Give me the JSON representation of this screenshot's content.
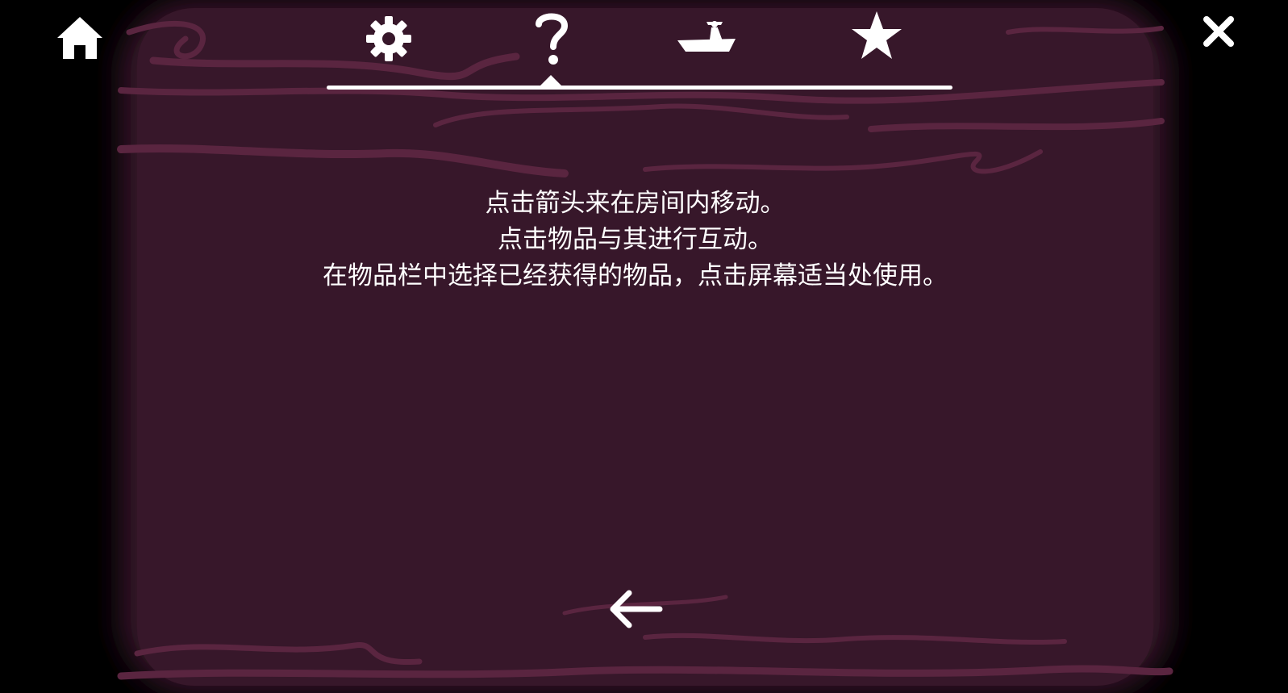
{
  "help": {
    "lines": [
      "点击箭头来在房间内移动。",
      "点击物品与其进行互动。",
      "在物品栏中选择已经获得的物品，点击屏幕适当处使用。"
    ]
  },
  "nav": {
    "tabs": [
      {
        "icon": "gear-icon",
        "selected": false
      },
      {
        "icon": "question-mark-icon",
        "selected": true
      },
      {
        "icon": "boat-icon",
        "selected": false
      },
      {
        "icon": "star-icon",
        "selected": false
      }
    ],
    "home_icon": "home-icon",
    "close_icon": "close-icon",
    "back_icon": "arrow-left-icon"
  },
  "colors": {
    "background": "#37172a",
    "wave": "#5a2540",
    "foreground": "#ffffff",
    "frame": "#000000"
  }
}
